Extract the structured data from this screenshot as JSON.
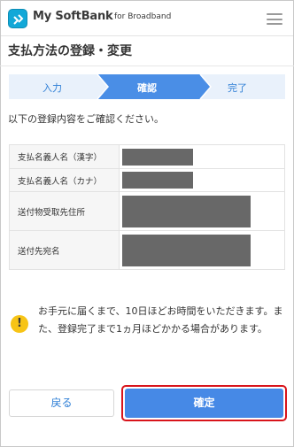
{
  "header": {
    "brand": "My SoftBank",
    "brand_sub": "for Broadband",
    "logo_icon": "softbank-logo-icon",
    "menu_icon": "hamburger-menu-icon"
  },
  "page_title": "支払方法の登録・変更",
  "steps": [
    {
      "label": "入力",
      "state": "done"
    },
    {
      "label": "確認",
      "state": "current"
    },
    {
      "label": "完了",
      "state": "upcoming"
    }
  ],
  "intro": "以下の登録内容をご確認ください。",
  "table": {
    "rows": [
      {
        "label": "支払名義人名（漢字）",
        "value": ""
      },
      {
        "label": "支払名義人名（カナ）",
        "value": ""
      },
      {
        "label": "送付物受取先住所",
        "value": ""
      },
      {
        "label": "送付先宛名",
        "value": ""
      }
    ]
  },
  "notice": {
    "icon": "exclamation-icon",
    "text": "お手元に届くまで、10日ほどお時間をいただきます。また、登録完了まで1ヵ月ほどかかる場合があります。"
  },
  "buttons": {
    "back": "戻る",
    "confirm": "確定"
  },
  "colors": {
    "accent": "#4689e6",
    "step_active": "#4a8ee6",
    "step_inactive": "#e9f1fb",
    "highlight": "#d8141b",
    "warning": "#f7c416",
    "redaction": "#686868"
  }
}
